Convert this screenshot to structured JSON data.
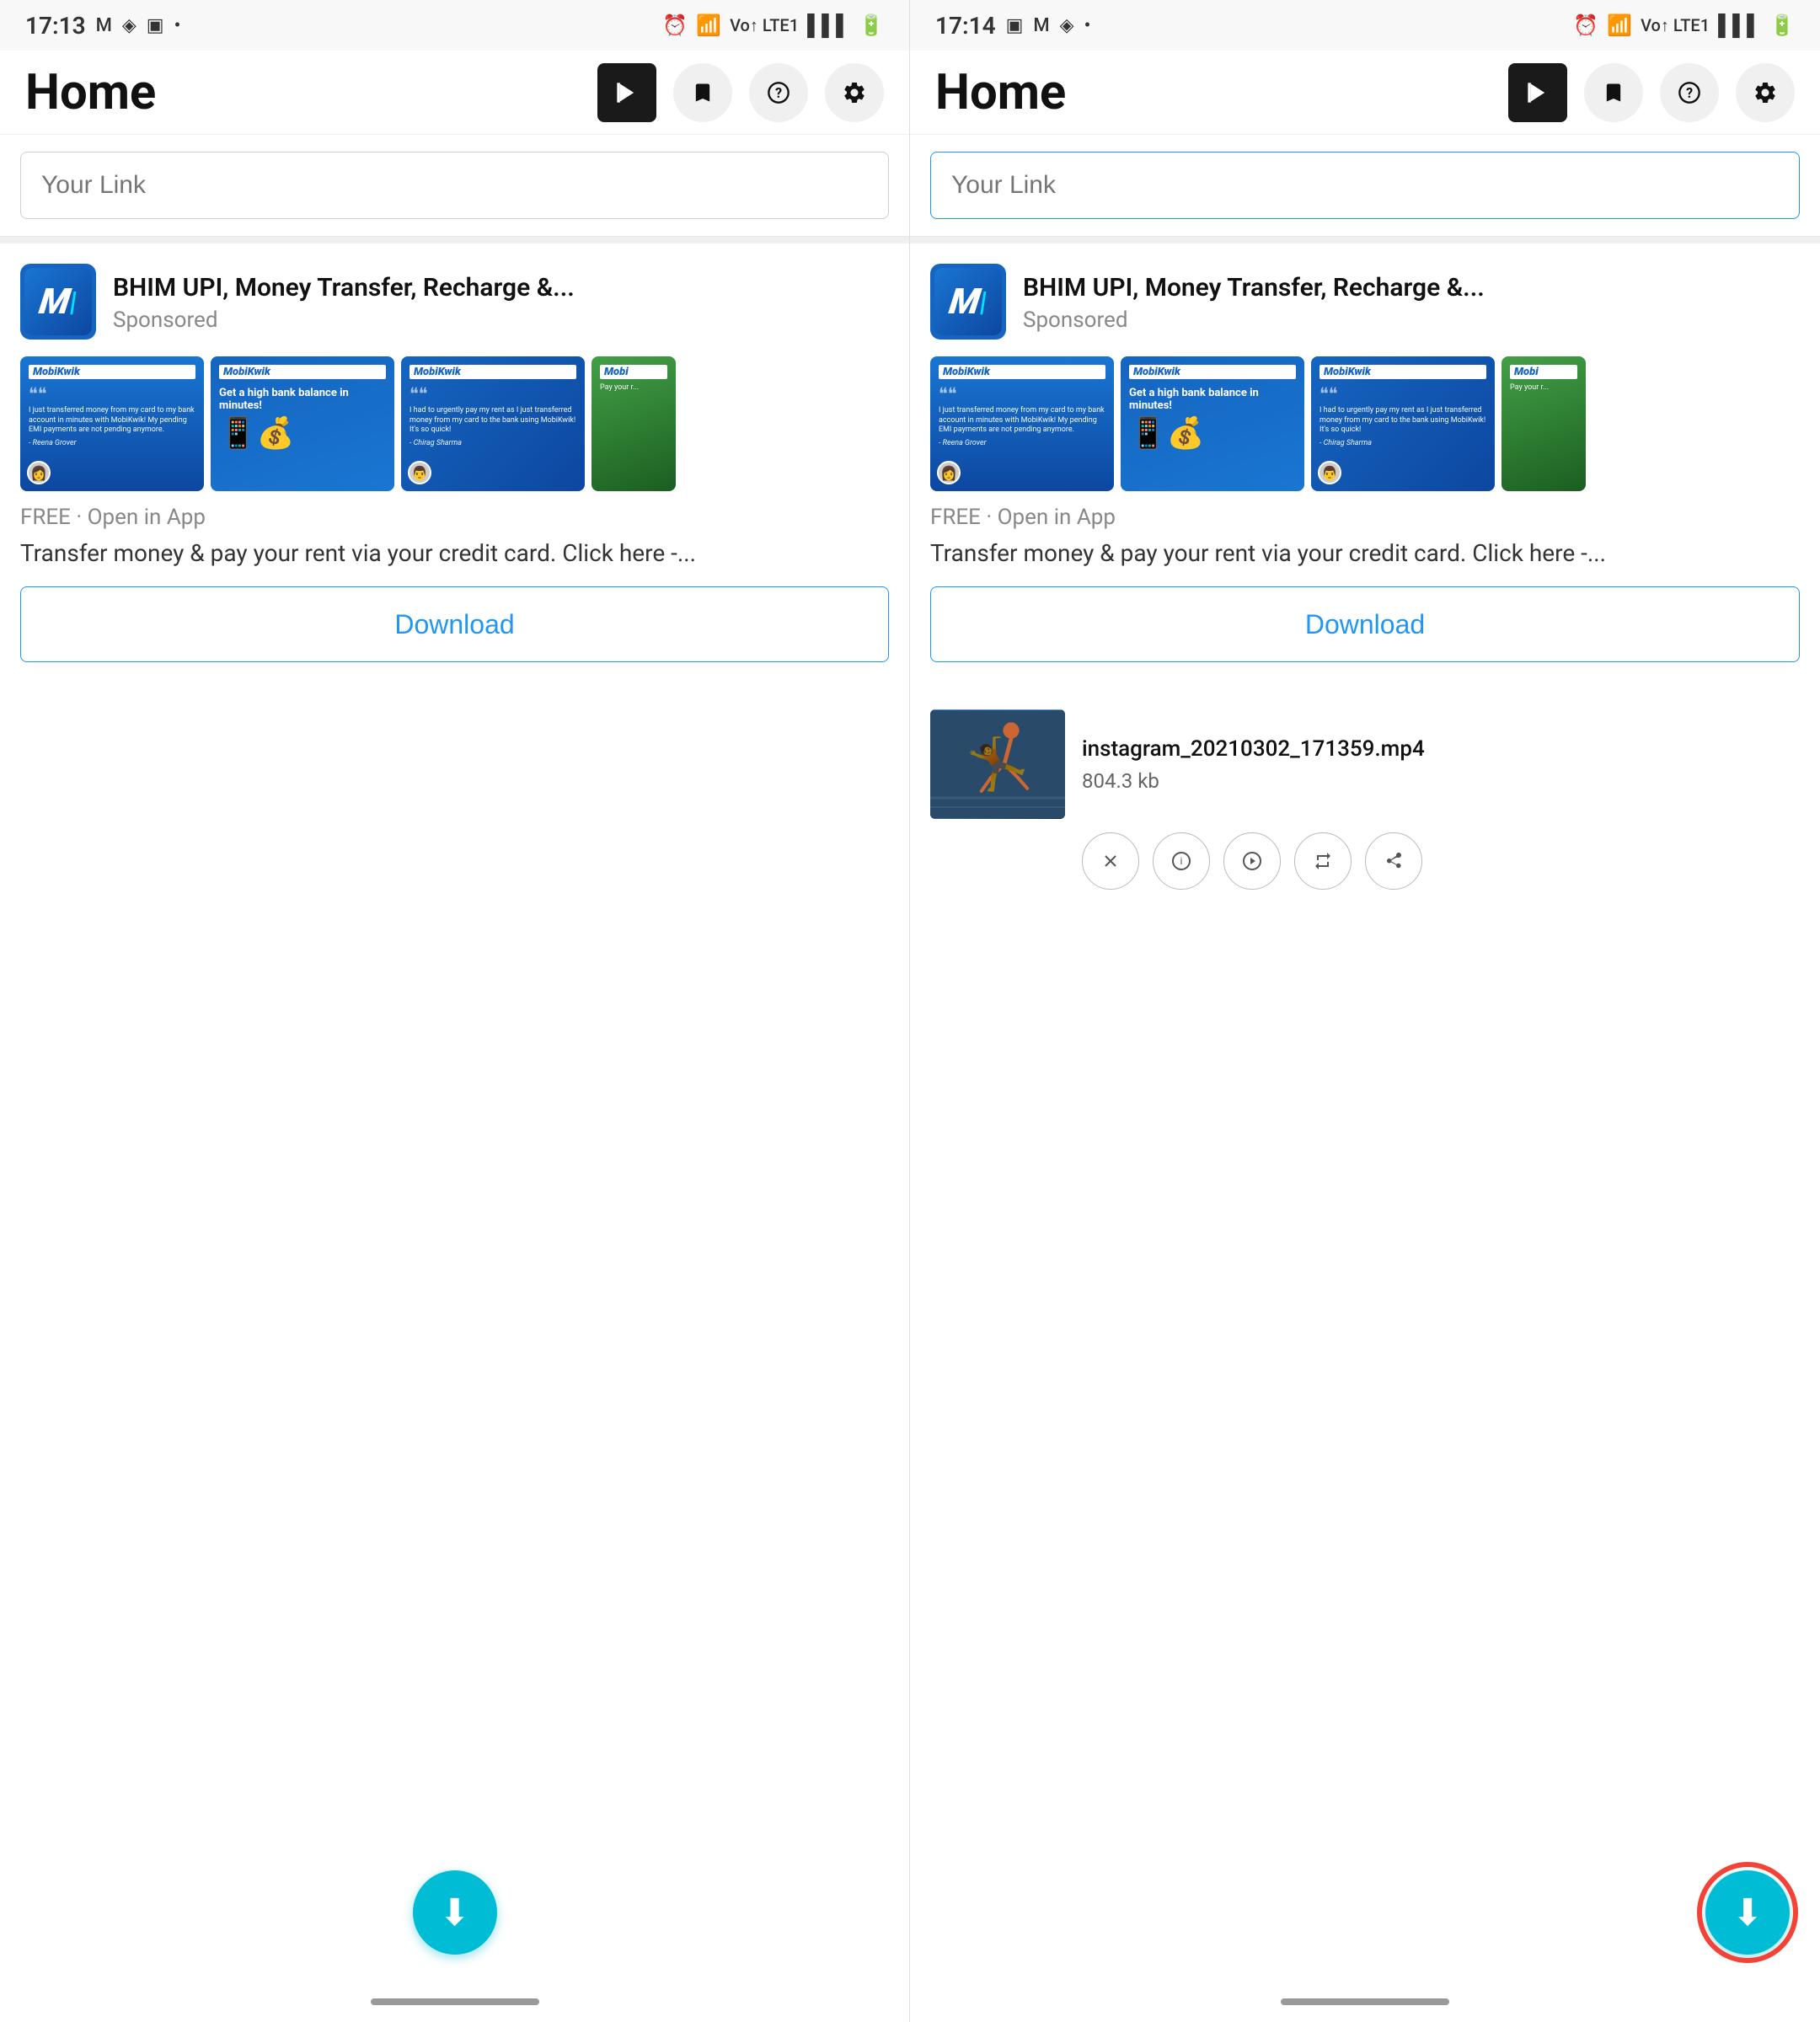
{
  "panels": [
    {
      "id": "panel-left",
      "status_bar": {
        "time": "17:13",
        "icons_left": [
          "M",
          "◈",
          "▣",
          "•"
        ],
        "icons_right": [
          "⏰",
          "wifi",
          "Vo LTE1",
          "signal",
          "battery"
        ]
      },
      "header": {
        "title": "Home",
        "icons": [
          "play-icon",
          "bookmark-icon",
          "help-icon",
          "settings-icon"
        ]
      },
      "link_input": {
        "placeholder": "Your Link",
        "value": "",
        "focused": false
      },
      "ad": {
        "logo_text": "M",
        "title": "BHIM UPI, Money Transfer, Recharge &...",
        "sponsored": "Sponsored",
        "free_text": "FREE · Open in App",
        "description": "Transfer money & pay your rent via your credit card. Click here -...",
        "download_label": "Download"
      },
      "fab": {
        "icon": "⬇",
        "highlighted": false
      }
    },
    {
      "id": "panel-right",
      "status_bar": {
        "time": "17:14",
        "icons_left": [
          "▣",
          "M",
          "◈",
          "•"
        ],
        "icons_right": [
          "⏰",
          "wifi",
          "Vo LTE1",
          "signal",
          "battery"
        ]
      },
      "header": {
        "title": "Home",
        "icons": [
          "play-icon",
          "bookmark-icon",
          "help-icon",
          "settings-icon"
        ]
      },
      "link_input": {
        "placeholder": "Your Link",
        "value": "",
        "focused": true
      },
      "ad": {
        "logo_text": "M",
        "title": "BHIM UPI, Money Transfer, Recharge &...",
        "sponsored": "Sponsored",
        "free_text": "FREE · Open in App",
        "description": "Transfer money & pay your rent via your credit card. Click here -...",
        "download_label": "Download"
      },
      "downloaded_file": {
        "name": "instagram_20210302_171359.mp4",
        "size": "804.3 kb",
        "actions": [
          "close",
          "info",
          "play",
          "repeat",
          "share"
        ]
      },
      "fab": {
        "icon": "⬇",
        "highlighted": true
      }
    }
  ],
  "ad_images": [
    {
      "type": "quote",
      "text": "I just transferred money from my card to my bank account in minutes with MobiKwik! My pending EMI payments are not pending anymore. - Reena Grover"
    },
    {
      "type": "promo",
      "text": "Get a high bank balance in minutes!"
    },
    {
      "type": "quote2",
      "text": "I had to urgently pay my rent as I just transferred money from my card to the bank using MobiKwik! It's so quick! - Chirag Sharma"
    },
    {
      "type": "partial",
      "text": "Pay your r..."
    }
  ]
}
